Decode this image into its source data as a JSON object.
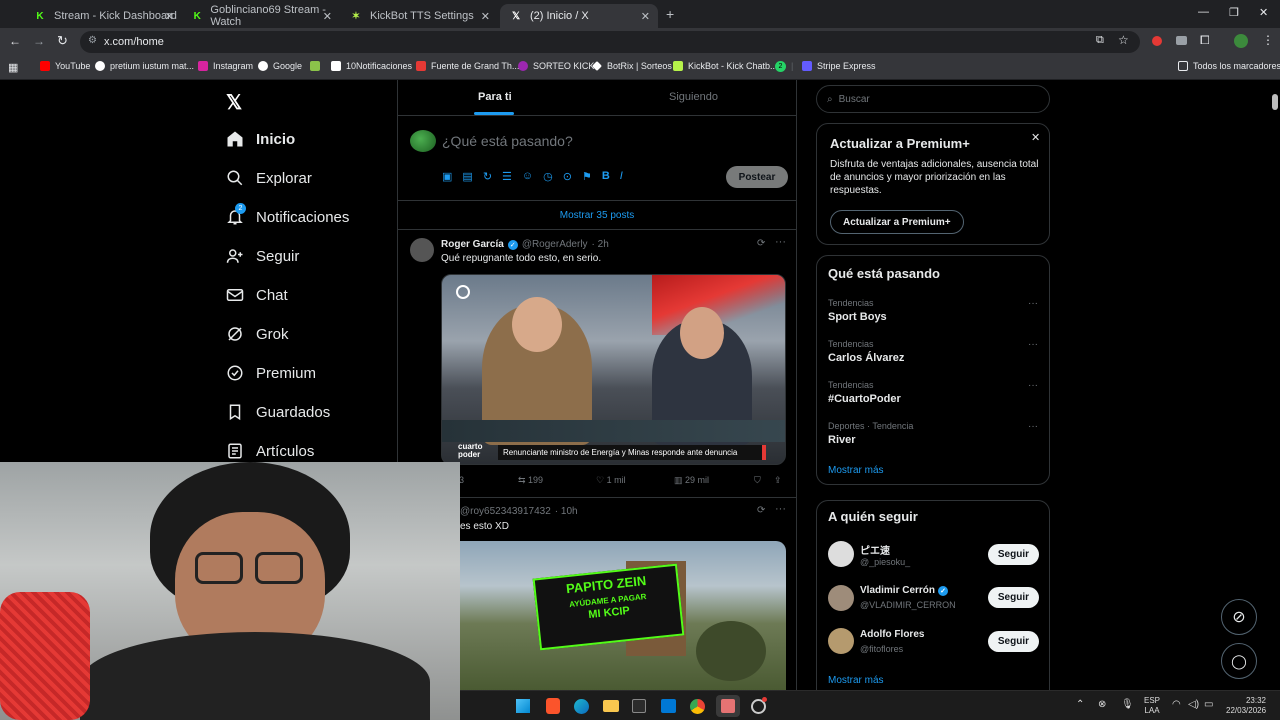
{
  "browser": {
    "tabs": [
      {
        "title": "Stream - Kick Dashboard",
        "active": false
      },
      {
        "title": "Goblinciano69 Stream - Watch",
        "active": false
      },
      {
        "title": "KickBot TTS Settings",
        "active": false
      },
      {
        "title": "(2) Inicio / X",
        "active": true
      }
    ],
    "url": "x.com/home",
    "bookmarks": [
      "YouTube",
      "pretium iustum mat...",
      "Instagram",
      "Google",
      "10Notificaciones",
      "Fuente de Grand Th...",
      "SORTEO KICK",
      "BotRix | Sorteos",
      "KickBot - Kick Chatb...",
      "2",
      "Stripe Express",
      "Todos los marcadores"
    ]
  },
  "sidebar": {
    "items": [
      {
        "label": "Inicio",
        "icon": "home-icon"
      },
      {
        "label": "Explorar",
        "icon": "search-icon"
      },
      {
        "label": "Notificaciones",
        "icon": "bell-icon",
        "badge": "2"
      },
      {
        "label": "Seguir",
        "icon": "follow-icon"
      },
      {
        "label": "Chat",
        "icon": "mail-icon"
      },
      {
        "label": "Grok",
        "icon": "grok-icon"
      },
      {
        "label": "Premium",
        "icon": "verified-icon"
      },
      {
        "label": "Guardados",
        "icon": "bookmark-icon"
      },
      {
        "label": "Artículos",
        "icon": "article-icon"
      }
    ]
  },
  "feed": {
    "tabs": [
      "Para ti",
      "Siguiendo"
    ],
    "compose_placeholder": "¿Qué está pasando?",
    "post_button": "Postear",
    "show_posts": "Mostrar 35 posts",
    "posts": [
      {
        "name": "Roger García",
        "handle": "@RogerAderly",
        "time": "· 2h",
        "text": "Qué repugnante todo esto, en serio.",
        "caption": "Renunciante ministro de Energía y Minas responde ante denuncia",
        "channel": "cuarto poder",
        "replies": "3",
        "reposts": "199",
        "likes": "1 mil",
        "views": "29 mil"
      },
      {
        "handle": "@roy652343917432",
        "time": "· 10h",
        "text": "es esto XD",
        "sign_lines": [
          "PAPITO ZEIN",
          "AYÚDAME A PAGAR",
          "MI KCIP"
        ]
      }
    ]
  },
  "right": {
    "search_placeholder": "Buscar",
    "premium": {
      "title": "Actualizar a Premium+",
      "body": "Disfruta de ventajas adicionales, ausencia total de anuncios y mayor priorización en las respuestas.",
      "button": "Actualizar a Premium+"
    },
    "trends_title": "Qué está pasando",
    "trends": [
      {
        "category": "Tendencias",
        "name": "Sport Boys"
      },
      {
        "category": "Tendencias",
        "name": "Carlos Álvarez"
      },
      {
        "category": "Tendencias",
        "name": "#CuartoPoder"
      },
      {
        "category": "Deportes · Tendencia",
        "name": "River"
      }
    ],
    "show_more": "Mostrar más",
    "follow_title": "A quién seguir",
    "follow": [
      {
        "name": "ピエ速",
        "handle": "@_piesoku_",
        "button": "Seguir"
      },
      {
        "name": "Vladimir Cerrón",
        "handle": "@VLADIMIR_CERRON",
        "button": "Seguir"
      },
      {
        "name": "Adolfo Flores",
        "handle": "@fitoflores",
        "button": "Seguir"
      }
    ],
    "follow_show_more": "Mostrar más"
  },
  "taskbar": {
    "lang": "ESP",
    "lang2": "LAA",
    "time": "23:32",
    "date": "22/03/2026"
  },
  "colors": {
    "accent": "#1d9bf0",
    "kick": "#53fc18",
    "bg": "#000000"
  }
}
